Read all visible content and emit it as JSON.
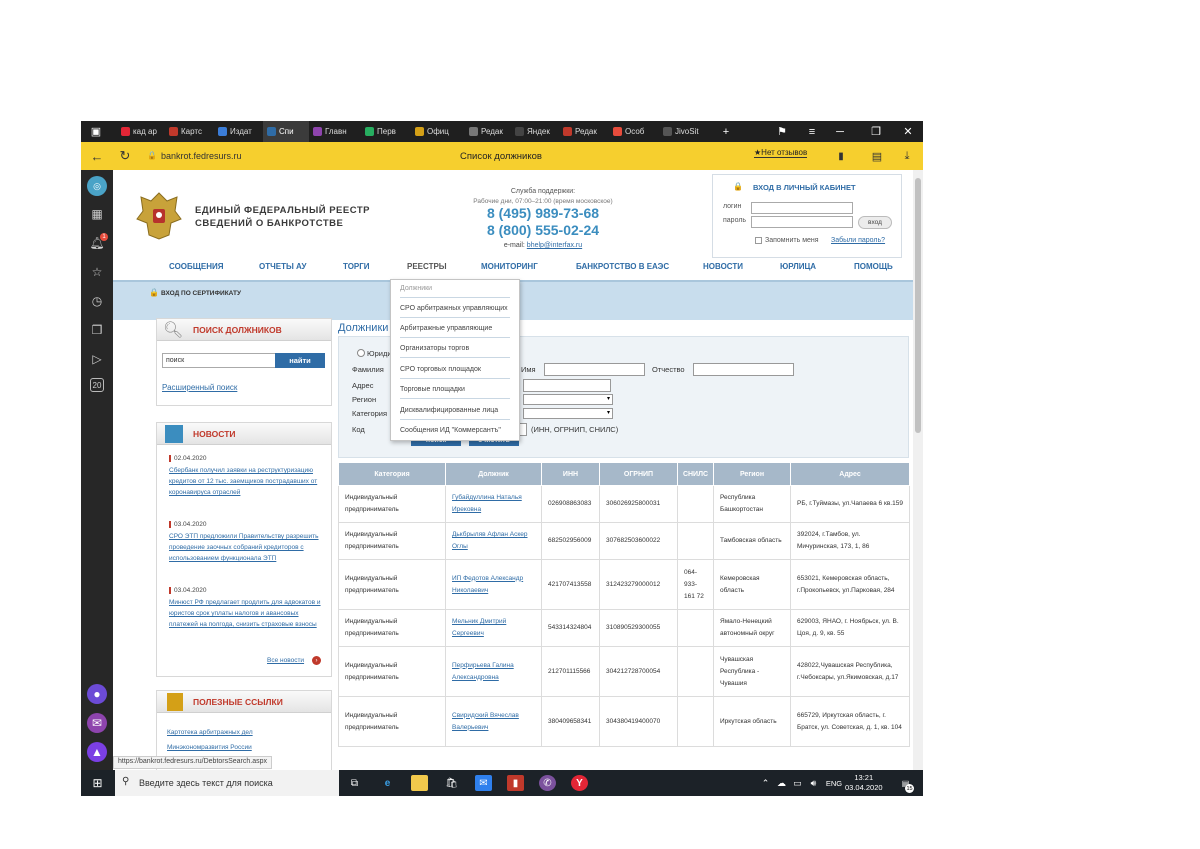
{
  "tabs": [
    {
      "label": "кад ар",
      "color": "#e32636"
    },
    {
      "label": "Картс",
      "color": "#c0392b"
    },
    {
      "label": "Издат",
      "color": "#3b7dd8"
    },
    {
      "label": "Спи",
      "color": "#2f6ca6",
      "active": true
    },
    {
      "label": "Главн",
      "color": "#8e44ad"
    },
    {
      "label": "Перв",
      "color": "#27ae60"
    },
    {
      "label": "Офиц",
      "color": "#d4a017"
    },
    {
      "label": "Редак",
      "color": "#777777"
    },
    {
      "label": "Яндек",
      "color": "#444444"
    },
    {
      "label": "Редак",
      "color": "#c0392b"
    },
    {
      "label": "Особ",
      "color": "#e74c3c"
    },
    {
      "label": "JivoSit",
      "color": "#555555"
    }
  ],
  "browser": {
    "url": "bankrot.fedresurs.ru",
    "page_title": "Список должников",
    "reviews": "★Нет отзывов",
    "status_url": "https://bankrot.fedresurs.ru/DebtorsSearch.aspx",
    "sidebar_badge": "1",
    "sidebar_counter": "20"
  },
  "site": {
    "title_line1": "ЕДИНЫЙ ФЕДЕРАЛЬНЫЙ РЕЕСТР",
    "title_line2": "СВЕДЕНИЙ О БАНКРОТСТВЕ",
    "support_title": "Служба поддержки:",
    "support_hours": "Рабочие дни, 07:00–21:00 (время московское)",
    "phone1": "8 (495) 989-73-68",
    "phone2": "8 (800) 555-02-24",
    "email_label": "e-mail:",
    "email": "bhelp@interfax.ru"
  },
  "login": {
    "title": "ВХОД В ЛИЧНЫЙ КАБИНЕТ",
    "login_label": "логин",
    "password_label": "пароль",
    "submit": "вход",
    "remember": "Запомнить меня",
    "forgot": "Забыли пароль?"
  },
  "nav": [
    "СООБЩЕНИЯ",
    "ОТЧЕТЫ АУ",
    "ТОРГИ",
    "РЕЕСТРЫ",
    "МОНИТОРИНГ",
    "БАНКРОТСТВО В ЕАЭС",
    "НОВОСТИ",
    "ЮРЛИЦА",
    "ПОМОЩЬ"
  ],
  "cert_login": "ВХОД ПО СЕРТИФИКАТУ",
  "dropdown": [
    "Должники",
    "СРО арбитражных управляющих",
    "Арбитражные управляющие",
    "Организаторы торгов",
    "СРО торговых площадок",
    "Торговые площадки",
    "Дисквалифицированные лица",
    "Сообщения ИД \"Коммерсантъ\""
  ],
  "search": {
    "title": "ПОИСК ДОЛЖНИКОВ",
    "placeholder": "поиск",
    "button": "найти",
    "advanced": "Расширенный поиск"
  },
  "news": {
    "title": "НОВОСТИ",
    "items": [
      {
        "date": "02.04.2020",
        "text": "Сбербанк получил заявки на реструктуризацию кредитов от 12 тыс. заемщиков пострадавших от коронавируса отраслей"
      },
      {
        "date": "03.04.2020",
        "text": "СРО ЭТП предложили Правительству разрешить проведение заочных собраний кредиторов с использованием функционала ЭТП"
      },
      {
        "date": "03.04.2020",
        "text": "Минюст РФ предлагает продлить для адвокатов и юристов срок уплаты налогов и авансовых платежей на полгода, снизить страховые взносы"
      }
    ],
    "all": "Все новости"
  },
  "useful": {
    "title": "ПОЛЕЗНЫЕ ССЫЛКИ",
    "links": [
      "Картотека арбитражных дел",
      "Минэкономразвития России"
    ]
  },
  "form": {
    "heading": "Должники",
    "legal": "Юриди",
    "surname": "Фамилия",
    "name": "Имя",
    "patronymic": "Отчество",
    "address": "Адрес",
    "region": "Регион",
    "category": "Категория",
    "code": "Код",
    "code_hint": "(ИНН, ОГРНИП, СНИЛС)",
    "search_btn": "поиск",
    "clear_btn": "очистить"
  },
  "table": {
    "headers": [
      "Категория",
      "Должник",
      "ИНН",
      "ОГРНИП",
      "СНИЛС",
      "Регион",
      "Адрес"
    ],
    "rows": [
      [
        "Индивидуальный предприниматель",
        "Губайдуллина Наталья Ирековна",
        "026908863083",
        "306026925800031",
        "",
        "Республика Башкортостан",
        "РБ, г.Туймазы, ул.Чапаева 6 кв.159"
      ],
      [
        "Индивидуальный предприниматель",
        "Дькбрыляв Афлан Аскер Оглы",
        "682502956009",
        "307682503600022",
        "",
        "Тамбовская область",
        "392024, г.Тамбов, ул. Мичуринская, 173, 1, 86"
      ],
      [
        "Индивидуальный предприниматель",
        "ИП Федотов Александр Николаевич",
        "421707413558",
        "312423279000012",
        "064-933-161 72",
        "Кемеровская область",
        "653021, Кемеровская область, г.Прокопьевск, ул.Парковая, 284"
      ],
      [
        "Индивидуальный предприниматель",
        "Мельник Дмитрий Сергеевич",
        "543314324804",
        "310890529300055",
        "",
        "Ямало-Ненецкий автономный округ",
        "629003, ЯНАО, г. Ноябрьск, ул. В. Цоя, д. 9, кв. 55"
      ],
      [
        "Индивидуальный предприниматель",
        "Перфирьева Галина Александровна",
        "212701115566",
        "304212728700054",
        "",
        "Чувашская Республика - Чувашия",
        "428022,Чувашская Республика, г.Чебоксары, ул.Якимовская, д.17"
      ],
      [
        "Индивидуальный предприниматель",
        "Свиридский Вячеслав Валерьевич",
        "380409658341",
        "304380419400070",
        "",
        "Иркутская область",
        "665729, Иркутская область, г. Братск, ул. Советская, д. 1, кв. 104"
      ]
    ]
  },
  "taskbar": {
    "search_placeholder": "Введите здесь текст для поиска",
    "lang": "ENG",
    "time": "13:21",
    "date": "03.04.2020",
    "notif_count": "15"
  }
}
